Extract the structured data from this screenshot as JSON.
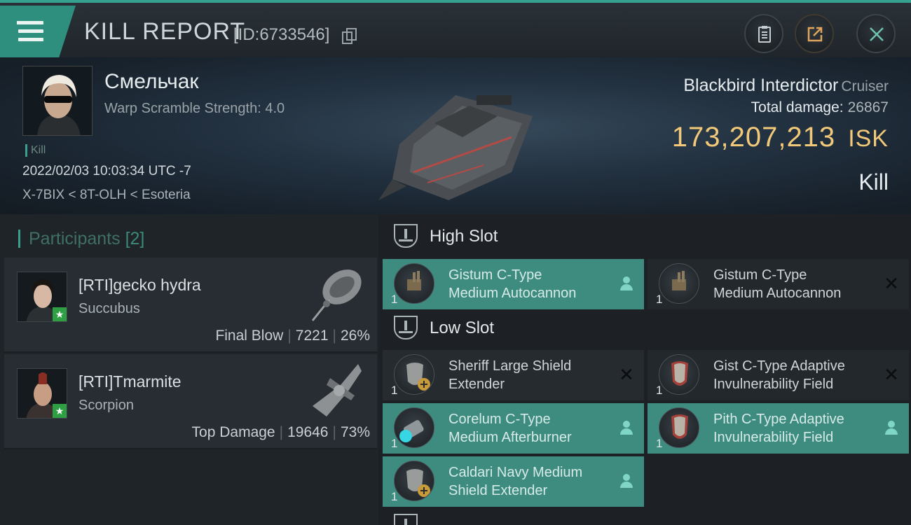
{
  "header": {
    "title": "KILL REPORT",
    "report_id": "[ID:6733546]",
    "icons": [
      "menu-icon",
      "copy-icon",
      "clipboard-icon",
      "share-icon",
      "close-icon"
    ]
  },
  "victim": {
    "name": "Смельчак",
    "warp_scramble": "Warp Scramble Strength: 4.0",
    "tag": "Kill",
    "timestamp": "2022/02/03 10:03:34 UTC -7",
    "location": "X-7BIX < 8T-OLH < Esoteria",
    "ship_name": "Blackbird Interdictor",
    "ship_class": "Cruiser",
    "total_damage_label": "Total damage:",
    "total_damage": "26867",
    "isk_value": "173,207,213",
    "isk_unit": "ISK",
    "result": "Kill"
  },
  "participants": {
    "label": "Participants",
    "count": "[2]",
    "rows": [
      {
        "name": "[RTI]gecko hydra",
        "ship": "Succubus",
        "role": "Final Blow",
        "damage": "7221",
        "percent": "26%"
      },
      {
        "name": "[RTI]Tmarmite",
        "ship": "Scorpion",
        "role": "Top Damage",
        "damage": "19646",
        "percent": "73%"
      }
    ]
  },
  "fittings": {
    "high_slot_label": "High Slot",
    "low_slot_label": "Low Slot",
    "items": [
      {
        "qty": "1",
        "line1": "Gistum C-Type",
        "line2": "Medium Autocannon",
        "status": "dropped"
      },
      {
        "qty": "1",
        "line1": "Gistum C-Type",
        "line2": "Medium Autocannon",
        "status": "destroyed"
      },
      {
        "qty": "1",
        "line1": "Sheriff Large Shield",
        "line2": "Extender",
        "status": "destroyed"
      },
      {
        "qty": "1",
        "line1": "Gist C-Type Adaptive",
        "line2": "Invulnerability Field",
        "status": "destroyed"
      },
      {
        "qty": "1",
        "line1": "Corelum C-Type",
        "line2": "Medium Afterburner",
        "status": "dropped"
      },
      {
        "qty": "1",
        "line1": "Pith C-Type Adaptive",
        "line2": "Invulnerability Field",
        "status": "dropped"
      },
      {
        "qty": "1",
        "line1": "Caldari Navy Medium",
        "line2": "Shield Extender",
        "status": "dropped"
      }
    ]
  },
  "colors": {
    "accent": "#3aa08d",
    "isk": "#f2c879",
    "dropped_bg": "#3e8b80"
  }
}
